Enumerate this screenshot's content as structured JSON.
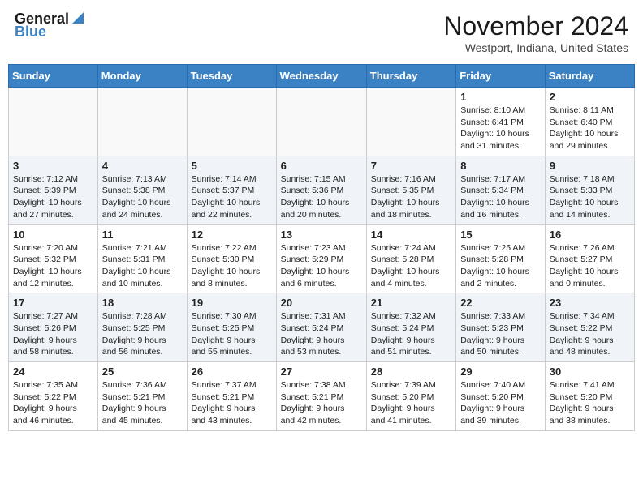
{
  "header": {
    "logo_line1": "General",
    "logo_line2": "Blue",
    "month": "November 2024",
    "location": "Westport, Indiana, United States"
  },
  "days_of_week": [
    "Sunday",
    "Monday",
    "Tuesday",
    "Wednesday",
    "Thursday",
    "Friday",
    "Saturday"
  ],
  "weeks": [
    [
      {
        "day": "",
        "info": ""
      },
      {
        "day": "",
        "info": ""
      },
      {
        "day": "",
        "info": ""
      },
      {
        "day": "",
        "info": ""
      },
      {
        "day": "",
        "info": ""
      },
      {
        "day": "1",
        "info": "Sunrise: 8:10 AM\nSunset: 6:41 PM\nDaylight: 10 hours\nand 31 minutes."
      },
      {
        "day": "2",
        "info": "Sunrise: 8:11 AM\nSunset: 6:40 PM\nDaylight: 10 hours\nand 29 minutes."
      }
    ],
    [
      {
        "day": "3",
        "info": "Sunrise: 7:12 AM\nSunset: 5:39 PM\nDaylight: 10 hours\nand 27 minutes."
      },
      {
        "day": "4",
        "info": "Sunrise: 7:13 AM\nSunset: 5:38 PM\nDaylight: 10 hours\nand 24 minutes."
      },
      {
        "day": "5",
        "info": "Sunrise: 7:14 AM\nSunset: 5:37 PM\nDaylight: 10 hours\nand 22 minutes."
      },
      {
        "day": "6",
        "info": "Sunrise: 7:15 AM\nSunset: 5:36 PM\nDaylight: 10 hours\nand 20 minutes."
      },
      {
        "day": "7",
        "info": "Sunrise: 7:16 AM\nSunset: 5:35 PM\nDaylight: 10 hours\nand 18 minutes."
      },
      {
        "day": "8",
        "info": "Sunrise: 7:17 AM\nSunset: 5:34 PM\nDaylight: 10 hours\nand 16 minutes."
      },
      {
        "day": "9",
        "info": "Sunrise: 7:18 AM\nSunset: 5:33 PM\nDaylight: 10 hours\nand 14 minutes."
      }
    ],
    [
      {
        "day": "10",
        "info": "Sunrise: 7:20 AM\nSunset: 5:32 PM\nDaylight: 10 hours\nand 12 minutes."
      },
      {
        "day": "11",
        "info": "Sunrise: 7:21 AM\nSunset: 5:31 PM\nDaylight: 10 hours\nand 10 minutes."
      },
      {
        "day": "12",
        "info": "Sunrise: 7:22 AM\nSunset: 5:30 PM\nDaylight: 10 hours\nand 8 minutes."
      },
      {
        "day": "13",
        "info": "Sunrise: 7:23 AM\nSunset: 5:29 PM\nDaylight: 10 hours\nand 6 minutes."
      },
      {
        "day": "14",
        "info": "Sunrise: 7:24 AM\nSunset: 5:28 PM\nDaylight: 10 hours\nand 4 minutes."
      },
      {
        "day": "15",
        "info": "Sunrise: 7:25 AM\nSunset: 5:28 PM\nDaylight: 10 hours\nand 2 minutes."
      },
      {
        "day": "16",
        "info": "Sunrise: 7:26 AM\nSunset: 5:27 PM\nDaylight: 10 hours\nand 0 minutes."
      }
    ],
    [
      {
        "day": "17",
        "info": "Sunrise: 7:27 AM\nSunset: 5:26 PM\nDaylight: 9 hours\nand 58 minutes."
      },
      {
        "day": "18",
        "info": "Sunrise: 7:28 AM\nSunset: 5:25 PM\nDaylight: 9 hours\nand 56 minutes."
      },
      {
        "day": "19",
        "info": "Sunrise: 7:30 AM\nSunset: 5:25 PM\nDaylight: 9 hours\nand 55 minutes."
      },
      {
        "day": "20",
        "info": "Sunrise: 7:31 AM\nSunset: 5:24 PM\nDaylight: 9 hours\nand 53 minutes."
      },
      {
        "day": "21",
        "info": "Sunrise: 7:32 AM\nSunset: 5:24 PM\nDaylight: 9 hours\nand 51 minutes."
      },
      {
        "day": "22",
        "info": "Sunrise: 7:33 AM\nSunset: 5:23 PM\nDaylight: 9 hours\nand 50 minutes."
      },
      {
        "day": "23",
        "info": "Sunrise: 7:34 AM\nSunset: 5:22 PM\nDaylight: 9 hours\nand 48 minutes."
      }
    ],
    [
      {
        "day": "24",
        "info": "Sunrise: 7:35 AM\nSunset: 5:22 PM\nDaylight: 9 hours\nand 46 minutes."
      },
      {
        "day": "25",
        "info": "Sunrise: 7:36 AM\nSunset: 5:21 PM\nDaylight: 9 hours\nand 45 minutes."
      },
      {
        "day": "26",
        "info": "Sunrise: 7:37 AM\nSunset: 5:21 PM\nDaylight: 9 hours\nand 43 minutes."
      },
      {
        "day": "27",
        "info": "Sunrise: 7:38 AM\nSunset: 5:21 PM\nDaylight: 9 hours\nand 42 minutes."
      },
      {
        "day": "28",
        "info": "Sunrise: 7:39 AM\nSunset: 5:20 PM\nDaylight: 9 hours\nand 41 minutes."
      },
      {
        "day": "29",
        "info": "Sunrise: 7:40 AM\nSunset: 5:20 PM\nDaylight: 9 hours\nand 39 minutes."
      },
      {
        "day": "30",
        "info": "Sunrise: 7:41 AM\nSunset: 5:20 PM\nDaylight: 9 hours\nand 38 minutes."
      }
    ]
  ]
}
